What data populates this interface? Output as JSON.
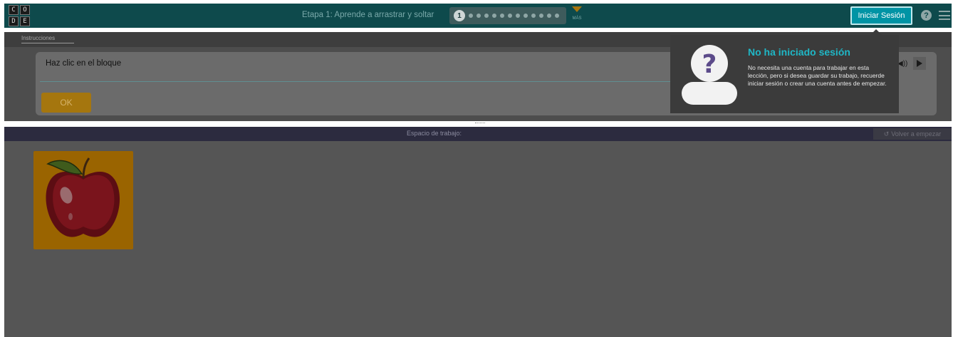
{
  "header": {
    "logo_letters": [
      "C",
      "O",
      "D",
      "E"
    ],
    "stage_title": "Etapa 1: Aprende a arrastrar y soltar",
    "current_level": "1",
    "remaining_levels": 12,
    "more_label": "MÁS",
    "signin_label": "Iniciar Sesión",
    "help_icon": "question-circle-icon",
    "menu_icon": "hamburger-icon"
  },
  "instructions": {
    "tab_label": "Instrucciones",
    "text": "Haz clic en el bloque",
    "ok_label": "OK",
    "speaker_icon": "speaker-icon",
    "play_icon": "play-icon"
  },
  "workspace": {
    "title": "Espacio de trabajo:",
    "restart_label": "Volver a empezar",
    "restart_icon": "refresh-icon",
    "block_image": "apple-icon"
  },
  "popover": {
    "title": "No ha iniciado sesión",
    "body": "No necesita una cuenta para trabajar en esta lección, pero si desea guardar su trabajo, recuerde iniciar sesión o crear una cuenta antes de empezar.",
    "icon": "unknown-user-icon"
  },
  "colors": {
    "header_bg": "#0e4a4c",
    "accent": "#1fb7c6",
    "signin_bg": "#0094a5",
    "ok_bg": "#a5760e",
    "workspace_header_bg": "#2c2b3f"
  }
}
